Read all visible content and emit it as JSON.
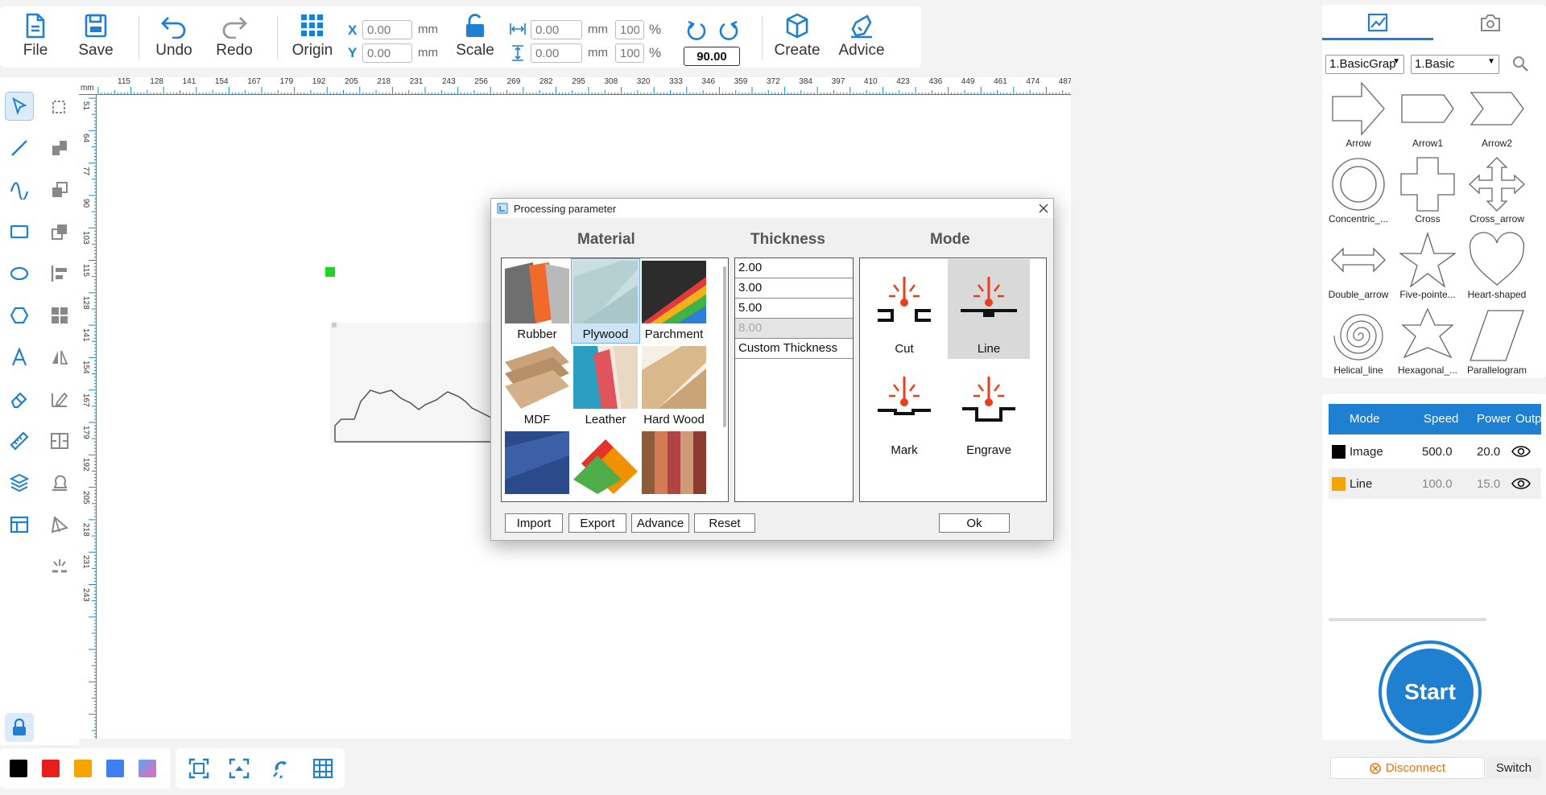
{
  "toolbar": {
    "file": "File",
    "save": "Save",
    "undo": "Undo",
    "redo": "Redo",
    "origin": "Origin",
    "scale": "Scale",
    "create": "Create",
    "advice": "Advice",
    "x_label": "X",
    "y_label": "Y",
    "x_value": "0.00",
    "y_value": "0.00",
    "w_value": "0.00",
    "h_value": "0.00",
    "w_pct": "100",
    "h_pct": "100",
    "unit": "mm",
    "pct": "%",
    "rotation": "90.00"
  },
  "ruler": {
    "unit": "mm",
    "top": [
      "115",
      "128",
      "141",
      "154",
      "167",
      "179",
      "192",
      "205",
      "218",
      "231",
      "243",
      "256",
      "269",
      "282",
      "295",
      "308",
      "320",
      "333",
      "346",
      "359",
      "372",
      "384",
      "397",
      "410",
      "423",
      "436",
      "449",
      "461",
      "474",
      "487"
    ],
    "left": [
      "51",
      "64",
      "77",
      "90",
      "103",
      "115",
      "128",
      "141",
      "154",
      "167",
      "179",
      "192",
      "205",
      "218",
      "231",
      "243"
    ]
  },
  "colors": [
    "#000000",
    "#e81e1e",
    "#f5a400",
    "#3d7ef0",
    "#d56ab5"
  ],
  "library": {
    "category": "1.BasicGrap",
    "subcategory": "1.Basic",
    "shapes": [
      {
        "name": "Arrow",
        "icon": "arrow-icon"
      },
      {
        "name": "Arrow1",
        "icon": "arrow1-icon"
      },
      {
        "name": "Arrow2",
        "icon": "arrow2-icon"
      },
      {
        "name": "Concentric_...",
        "icon": "concentric-icon"
      },
      {
        "name": "Cross",
        "icon": "cross-icon"
      },
      {
        "name": "Cross_arrow",
        "icon": "cross-arrow-icon"
      },
      {
        "name": "Double_arrow",
        "icon": "double-arrow-icon"
      },
      {
        "name": "Five-pointe...",
        "icon": "star-icon"
      },
      {
        "name": "Heart-shaped",
        "icon": "heart-icon"
      },
      {
        "name": "Helical_line",
        "icon": "spiral-icon"
      },
      {
        "name": "Hexagonal_...",
        "icon": "hexagram-icon"
      },
      {
        "name": "Parallelogram",
        "icon": "parallelogram-icon"
      }
    ]
  },
  "layers": {
    "headers": {
      "mode": "Mode",
      "speed": "Speed",
      "power": "Power",
      "output": "Output"
    },
    "rows": [
      {
        "color": "#000000",
        "mode": "Image",
        "speed": "500.0",
        "power": "20.0"
      },
      {
        "color": "#f5a400",
        "mode": "Line",
        "speed": "100.0",
        "power": "15.0"
      }
    ]
  },
  "start": "Start",
  "connection": {
    "status": "Disconnect",
    "switch": "Switch"
  },
  "dialog": {
    "title": "Processing parameter",
    "material_header": "Material",
    "thickness_header": "Thickness",
    "mode_header": "Mode",
    "materials": [
      {
        "name": "Rubber",
        "selected": false
      },
      {
        "name": "Plywood",
        "selected": true
      },
      {
        "name": "Parchment",
        "selected": false
      },
      {
        "name": "MDF",
        "selected": false
      },
      {
        "name": "Leather",
        "selected": false
      },
      {
        "name": "Hard Wood",
        "selected": false
      }
    ],
    "thicknesses": [
      "2.00",
      "3.00",
      "5.00",
      "8.00",
      "Custom Thickness"
    ],
    "modes": [
      {
        "name": "Cut",
        "selected": false
      },
      {
        "name": "Line",
        "selected": true
      },
      {
        "name": "Mark",
        "selected": false
      },
      {
        "name": "Engrave",
        "selected": false
      }
    ],
    "buttons": {
      "import": "Import",
      "export": "Export",
      "advance": "Advance",
      "reset": "Reset",
      "ok": "Ok"
    }
  }
}
